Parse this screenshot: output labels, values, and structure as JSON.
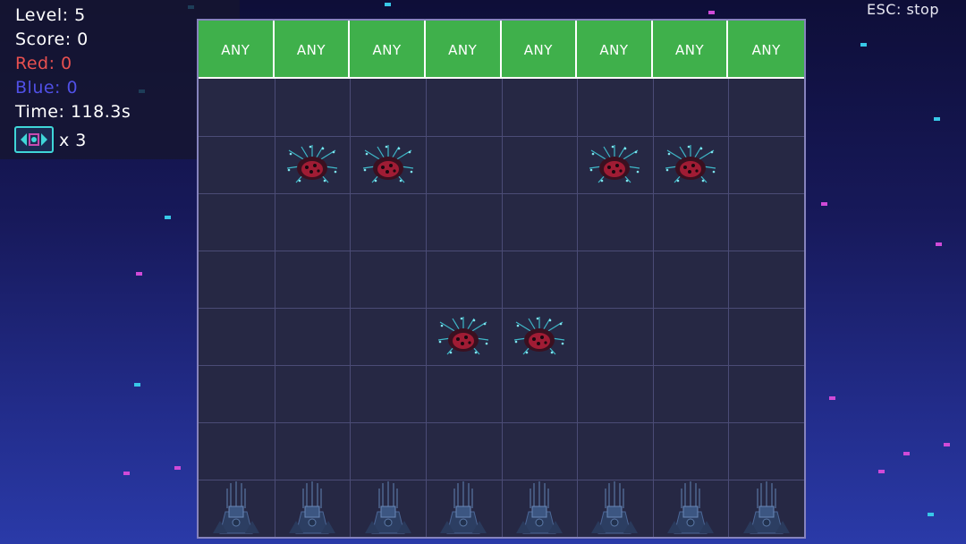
{
  "hud": {
    "level": "Level: 5",
    "score": "Score: 0",
    "red": "Red: 0",
    "blue": "Blue: 0",
    "time": "Time: 118.3s",
    "lives": "x 3",
    "lives_icon": "ship-emblem-icon"
  },
  "esc_hint": "ESC: stop",
  "board": {
    "columns": 8,
    "rows": 8,
    "column_labels": [
      "ANY",
      "ANY",
      "ANY",
      "ANY",
      "ANY",
      "ANY",
      "ANY",
      "ANY"
    ],
    "enemies": [
      {
        "row": 1,
        "col": 1
      },
      {
        "row": 1,
        "col": 2
      },
      {
        "row": 1,
        "col": 5
      },
      {
        "row": 1,
        "col": 6
      },
      {
        "row": 4,
        "col": 3
      },
      {
        "row": 4,
        "col": 4
      }
    ],
    "turret_row": 7,
    "turret_icon": "turret-icon",
    "enemy_icon": "spore-enemy-icon"
  },
  "colors": {
    "header": "#3fb04b",
    "red_text": "#e85050",
    "blue_text": "#5050e6",
    "board_bg": "#262844",
    "grid_line": "#4b4c76"
  }
}
